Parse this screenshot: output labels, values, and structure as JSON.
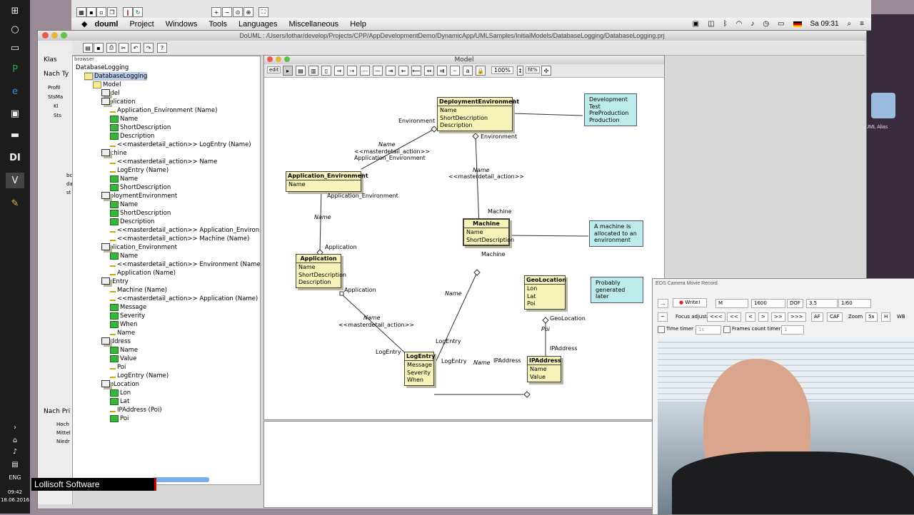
{
  "taskbar": {
    "lang": "ENG",
    "time": "09:42",
    "date": "18.06.2016"
  },
  "menubar": {
    "app": "douml",
    "items": [
      "Project",
      "Windows",
      "Tools",
      "Languages",
      "Miscellaneous",
      "Help"
    ],
    "clock": "Sa 09:31"
  },
  "window": {
    "title": "DoUML : /Users/lothar/develop/Projects/CPP/AppDevelopmentDemo/DynamicApp/UMLSamples/InitialModels/DatabaseLogging/DatabaseLogging.prj"
  },
  "left_panel": {
    "tab1": "Klas",
    "tab2": "Nach Ty",
    "tab3": "Nach Pri",
    "items": [
      "Profil",
      "StsMa",
      "Kl",
      "Sts",
      "bc",
      "da",
      "st"
    ],
    "priority": [
      "Hoch",
      "Mittel",
      "Niedr"
    ]
  },
  "browser": {
    "label": "browser",
    "rows": [
      {
        "t": "DatabaseLogging",
        "lvl": 0,
        "ic": "none"
      },
      {
        "t": "DatabaseLogging",
        "lvl": 1,
        "ic": "pkg",
        "sel": true
      },
      {
        "t": "Model",
        "lvl": 2,
        "ic": "pkg"
      },
      {
        "t": "Model",
        "lvl": 3,
        "ic": "cls"
      },
      {
        "t": "Application",
        "lvl": 3,
        "ic": "cls"
      },
      {
        "t": "Application_Environment (Name)",
        "lvl": 4,
        "ic": "rel"
      },
      {
        "t": "Name",
        "lvl": 4,
        "ic": "attr"
      },
      {
        "t": "ShortDescription",
        "lvl": 4,
        "ic": "attr"
      },
      {
        "t": "Description",
        "lvl": 4,
        "ic": "attr"
      },
      {
        "t": "<<masterdetail_action>> LogEntry (Name)",
        "lvl": 4,
        "ic": "rel"
      },
      {
        "t": "Machine",
        "lvl": 3,
        "ic": "cls"
      },
      {
        "t": "<<masterdetail_action>> Name",
        "lvl": 4,
        "ic": "rel"
      },
      {
        "t": "LogEntry (Name)",
        "lvl": 4,
        "ic": "rel"
      },
      {
        "t": "Name",
        "lvl": 4,
        "ic": "attr"
      },
      {
        "t": "ShortDescription",
        "lvl": 4,
        "ic": "attr"
      },
      {
        "t": "DeploymentEnvironment",
        "lvl": 3,
        "ic": "cls"
      },
      {
        "t": "Name",
        "lvl": 4,
        "ic": "attr"
      },
      {
        "t": "ShortDescription",
        "lvl": 4,
        "ic": "attr"
      },
      {
        "t": "Description",
        "lvl": 4,
        "ic": "attr"
      },
      {
        "t": "<<masterdetail_action>> Application_Environm",
        "lvl": 4,
        "ic": "rel"
      },
      {
        "t": "<<masterdetail_action>> Machine (Name)",
        "lvl": 4,
        "ic": "rel"
      },
      {
        "t": "Application_Environment",
        "lvl": 3,
        "ic": "cls"
      },
      {
        "t": "Name",
        "lvl": 4,
        "ic": "attr"
      },
      {
        "t": "<<masterdetail_action>> Environment (Name)",
        "lvl": 4,
        "ic": "rel"
      },
      {
        "t": "Application (Name)",
        "lvl": 4,
        "ic": "rel"
      },
      {
        "t": "LogEntry",
        "lvl": 3,
        "ic": "cls"
      },
      {
        "t": "Machine (Name)",
        "lvl": 4,
        "ic": "rel"
      },
      {
        "t": "<<masterdetail_action>> Application (Name)",
        "lvl": 4,
        "ic": "rel"
      },
      {
        "t": "Message",
        "lvl": 4,
        "ic": "attr"
      },
      {
        "t": "Severity",
        "lvl": 4,
        "ic": "attr"
      },
      {
        "t": "When",
        "lvl": 4,
        "ic": "attr"
      },
      {
        "t": "Name",
        "lvl": 4,
        "ic": "rel"
      },
      {
        "t": "IPAddress",
        "lvl": 3,
        "ic": "cls"
      },
      {
        "t": "Name",
        "lvl": 4,
        "ic": "attr"
      },
      {
        "t": "Value",
        "lvl": 4,
        "ic": "attr"
      },
      {
        "t": "Poi",
        "lvl": 4,
        "ic": "rel"
      },
      {
        "t": "LogEntry (Name)",
        "lvl": 4,
        "ic": "rel"
      },
      {
        "t": "GeoLocation",
        "lvl": 3,
        "ic": "cls"
      },
      {
        "t": "Lon",
        "lvl": 4,
        "ic": "attr"
      },
      {
        "t": "Lat",
        "lvl": 4,
        "ic": "attr"
      },
      {
        "t": "IPAddress (Poi)",
        "lvl": 4,
        "ic": "rel"
      },
      {
        "t": "Poi",
        "lvl": 4,
        "ic": "attr"
      }
    ]
  },
  "diagram": {
    "title": "Model",
    "mode": "edit",
    "zoom": "100%",
    "fit": "fit%",
    "classes": {
      "deploy": {
        "name": "DeploymentEnvironment",
        "attrs": [
          "Name",
          "ShortDescription",
          "Description"
        ]
      },
      "appenv": {
        "name": "Application_Environment",
        "attrs": [
          "Name"
        ]
      },
      "machine": {
        "name": "Machine",
        "attrs": [
          "Name",
          "ShortDescription"
        ]
      },
      "application": {
        "name": "Application",
        "attrs": [
          "Name",
          "ShortDescription",
          "Description"
        ]
      },
      "geo": {
        "name": "GeoLocation",
        "attrs": [
          "Lon",
          "Lat",
          "Poi"
        ]
      },
      "logentry": {
        "name": "LogEntry",
        "attrs": [
          "Message",
          "Severity",
          "When"
        ]
      },
      "ipaddr": {
        "name": "IPAddress",
        "attrs": [
          "Name",
          "Value"
        ]
      }
    },
    "notes": {
      "envs": [
        "Development",
        "Test",
        "PreProduction",
        "Production"
      ],
      "machine": [
        "A machine is",
        "allocated to an",
        "environment"
      ],
      "geo": [
        "Probably",
        "generated later"
      ]
    },
    "labels": {
      "environment1": "Environment",
      "environment2": "Environment",
      "name": "Name",
      "stereo": "<<masterdetail_action>>",
      "appenv": "Application_Environment",
      "appenv2": "Application_Environment",
      "application": "Application",
      "application2": "Application",
      "machine": "Machine",
      "machine2": "Machine",
      "logentry": "LogEntry",
      "logentry2": "LogEntry",
      "logentry3": "LogEntry",
      "ipaddress": "IPAddress",
      "ipaddress2": "IPAddress",
      "geolocation": "GeoLocation",
      "poi": "Poi"
    }
  },
  "eos": {
    "title": "EOS Camera Movie Record",
    "write": "Write!",
    "mode": "M",
    "iso": "1600",
    "dof": "DOF",
    "aperture": "3.5",
    "shutter": "1/60",
    "focus_adjust": "Focus adjust",
    "btns": [
      "<<<",
      "<<",
      "<",
      ">",
      ">>",
      ">>>"
    ],
    "af": "AF",
    "caf": "CAF",
    "zoom": "Zoom",
    "z5": "5x",
    "wb": "WB",
    "timer": "Time timer",
    "timer_val": "1s",
    "frames": "Frames count timer",
    "frames_val": "1"
  },
  "overlay": {
    "brand": "Lollisoft Software"
  },
  "alias": "UML Alias"
}
